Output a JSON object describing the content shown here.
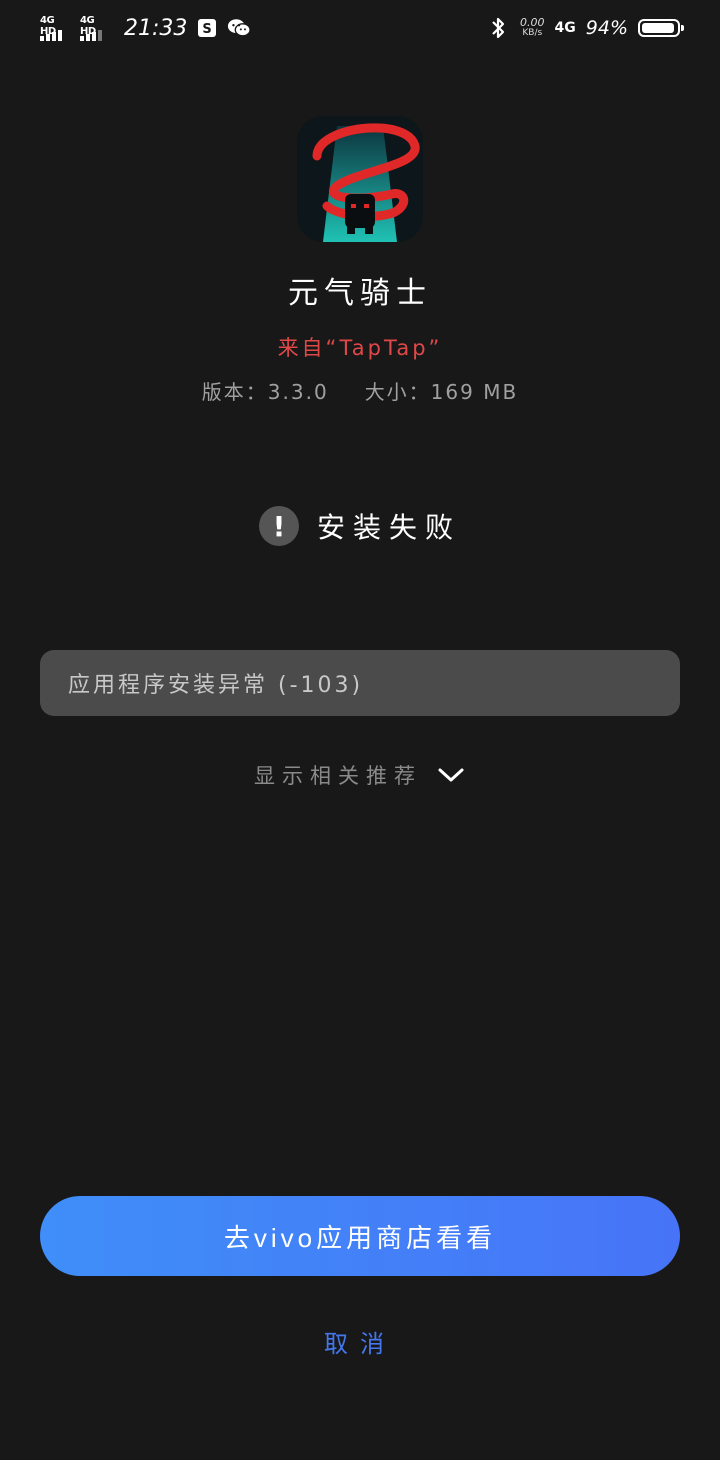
{
  "status_bar": {
    "sim1_label": "4G HD",
    "sim2_label": "4G HD",
    "time": "21:33",
    "net_speed_value": "0.00",
    "net_speed_unit": "KB/s",
    "network_type": "4G",
    "battery_percent": "94%",
    "battery_level": 0.94,
    "icons": [
      "signal-icon",
      "signal-icon",
      "notification-app-icon",
      "wechat-icon",
      "bluetooth-icon",
      "battery-icon"
    ]
  },
  "app": {
    "name": "元气骑士",
    "source": "来自“TapTap”",
    "version": "版本：3.3.0",
    "size": "大小：169 MB"
  },
  "install": {
    "status_icon": "exclamation-icon",
    "status": "安装失败",
    "error_message": "应用程序安装异常 (-103)"
  },
  "recommend": {
    "label": "显示相关推荐",
    "icon": "chevron-down-icon"
  },
  "actions": {
    "store_button": "去vivo应用商店看看",
    "cancel": "取消"
  },
  "colors": {
    "background": "#181818",
    "accent": "#4477ee",
    "source_text": "#e04848",
    "button_start": "#3f8ef9",
    "button_end": "#4774f7"
  }
}
